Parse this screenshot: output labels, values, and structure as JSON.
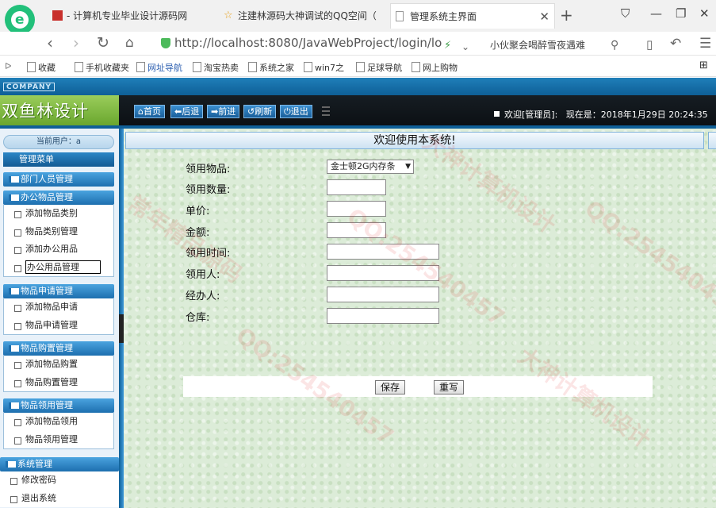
{
  "browser": {
    "tabs": [
      {
        "label": "- 计算机专业毕业设计源码网"
      },
      {
        "label": "注建林源码大神调试的QQ空间（"
      },
      {
        "label": "管理系统主界面"
      }
    ],
    "new_tab": "+",
    "url": "http://localhost:8080/JavaWebProject/login/lo",
    "search_text": "小伙聚会喝醉雪夜遇难",
    "bookmarks": [
      "收藏",
      "手机收藏夹",
      "网址导航",
      "淘宝热卖",
      "系统之家",
      "win7之",
      "足球导航",
      "网上购物"
    ]
  },
  "app": {
    "company": "COMPANY",
    "logo": "双鱼林设计",
    "nav_buttons": [
      "首页",
      "后退",
      "前进",
      "刷新",
      "退出"
    ],
    "welcome": "欢迎[管理员]:",
    "time_label": "现在是：2018年1月29日 20:24:35",
    "colors": {
      "header": "#0e1216",
      "accent": "#1d6faf",
      "content_bg": "#dcecd8"
    }
  },
  "sidebar": {
    "current_user": "当前用户：a",
    "menu_title": "管理菜单",
    "sections": [
      {
        "title": "部门人员管理",
        "items": []
      },
      {
        "title": "办公物品管理",
        "items": [
          "添加物品类别",
          "物品类别管理",
          "添加办公用品",
          "办公用品管理"
        ]
      },
      {
        "title": "物品申请管理",
        "items": [
          "添加物品申请",
          "物品申请管理"
        ]
      },
      {
        "title": "物品购置管理",
        "items": [
          "添加物品购置",
          "物品购置管理"
        ]
      },
      {
        "title": "物品领用管理",
        "items": [
          "添加物品领用",
          "物品领用管理"
        ]
      },
      {
        "title": "系统管理",
        "items": [
          "修改密码",
          "退出系统"
        ]
      }
    ]
  },
  "content": {
    "title": "欢迎使用本系统!",
    "form": {
      "item_label": "领用物品:",
      "item_selected": "金士顿2G内存条",
      "qty_label": "领用数量:",
      "price_label": "单价:",
      "amount_label": "金额:",
      "time_label": "领用时间:",
      "user_label": "领用人:",
      "handler_label": "经办人:",
      "warehouse_label": "仓库:",
      "save_label": "保存",
      "reset_label": "重写"
    }
  },
  "watermarks": [
    "大神计算机设计",
    "QQ:254540457",
    "常年精品源码"
  ]
}
